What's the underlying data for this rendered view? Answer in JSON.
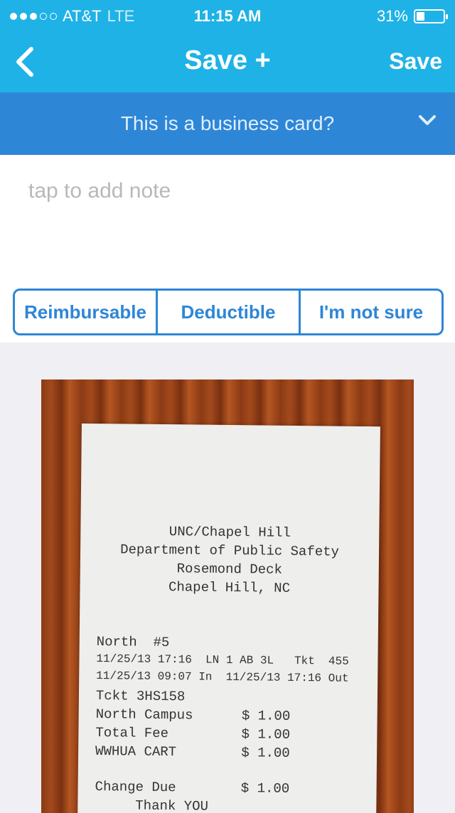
{
  "status_bar": {
    "carrier": "AT&T",
    "network": "LTE",
    "time": "11:15 AM",
    "battery": "31%",
    "battery_level": 0.31
  },
  "nav": {
    "back_icon": "chevron-left-icon",
    "title": "Save +",
    "save_label": "Save"
  },
  "banner": {
    "text": "This is a business card?",
    "icon": "chevron-down-icon"
  },
  "note": {
    "placeholder": "tap to add note",
    "value": ""
  },
  "tags": [
    "Reimbursable",
    "Deductible",
    "I'm not sure"
  ],
  "receipt": {
    "header_lines": [
      "UNC/Chapel Hill",
      "Department of Public Safety",
      "Rosemond Deck",
      "Chapel Hill, NC"
    ],
    "body_lines": [
      "North  #5",
      "11/25/13 17:16  LN 1 AB 3L   Tkt  455",
      "11/25/13 09:07 In  11/25/13 17:16 Out",
      "Tckt 3HS158",
      "North Campus      $ 1.00",
      "Total Fee         $ 1.00",
      "WWHUA CART        $ 1.00",
      "",
      "Change Due        $ 1.00",
      "     Thank YOU"
    ]
  },
  "colors": {
    "header_bg": "#1fb2e6",
    "banner_bg": "#2e86d6",
    "accent": "#2e86d6"
  }
}
